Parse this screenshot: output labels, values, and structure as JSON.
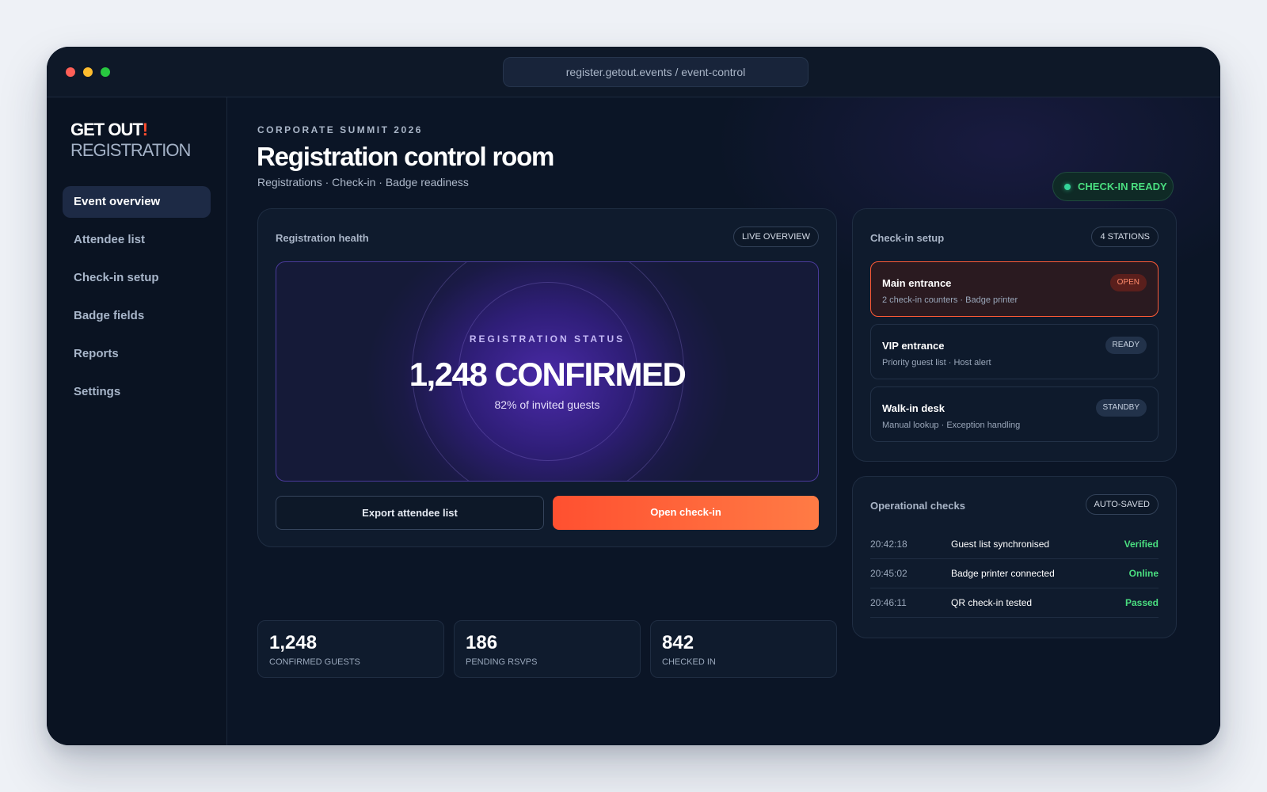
{
  "browser": {
    "url": "register.getout.events / event-control"
  },
  "brand": {
    "name": "GET OUT",
    "mark": "!",
    "product": "REGISTRATION"
  },
  "sidebar": {
    "items": [
      {
        "label": "Event overview"
      },
      {
        "label": "Attendee list"
      },
      {
        "label": "Check-in setup"
      },
      {
        "label": "Badge fields"
      },
      {
        "label": "Reports"
      },
      {
        "label": "Settings"
      }
    ]
  },
  "header": {
    "eyebrow": "CORPORATE SUMMIT 2026",
    "title": "Registration control room",
    "subtitle": "Registrations · Check-in · Badge readiness",
    "status": "CHECK-IN READY"
  },
  "health": {
    "title": "Registration health",
    "chip": "LIVE OVERVIEW",
    "hero_label": "REGISTRATION STATUS",
    "hero_value": "1,248 CONFIRMED",
    "hero_sub": "82% of invited guests",
    "export_label": "Export attendee list",
    "open_label": "Open check-in"
  },
  "stats": [
    {
      "value": "1,248",
      "label": "CONFIRMED GUESTS"
    },
    {
      "value": "186",
      "label": "PENDING RSVPS"
    },
    {
      "value": "842",
      "label": "CHECKED IN"
    }
  ],
  "setup": {
    "title": "Check-in setup",
    "chip": "4 STATIONS",
    "stations": [
      {
        "name": "Main entrance",
        "desc": "2 check-in counters · Badge printer",
        "status": "OPEN"
      },
      {
        "name": "VIP entrance",
        "desc": "Priority guest list · Host alert",
        "status": "READY"
      },
      {
        "name": "Walk-in desk",
        "desc": "Manual lookup · Exception handling",
        "status": "STANDBY"
      }
    ]
  },
  "checks": {
    "title": "Operational checks",
    "chip": "AUTO-SAVED",
    "rows": [
      {
        "time": "20:42:18",
        "label": "Guest list synchronised",
        "status": "Verified"
      },
      {
        "time": "20:45:02",
        "label": "Badge printer connected",
        "status": "Online"
      },
      {
        "time": "20:46:11",
        "label": "QR check-in tested",
        "status": "Passed"
      }
    ]
  },
  "colors": {
    "accent": "#ff5a36",
    "success": "#4ade80",
    "background": "#0b1526",
    "hero": "#4a2aa8"
  }
}
